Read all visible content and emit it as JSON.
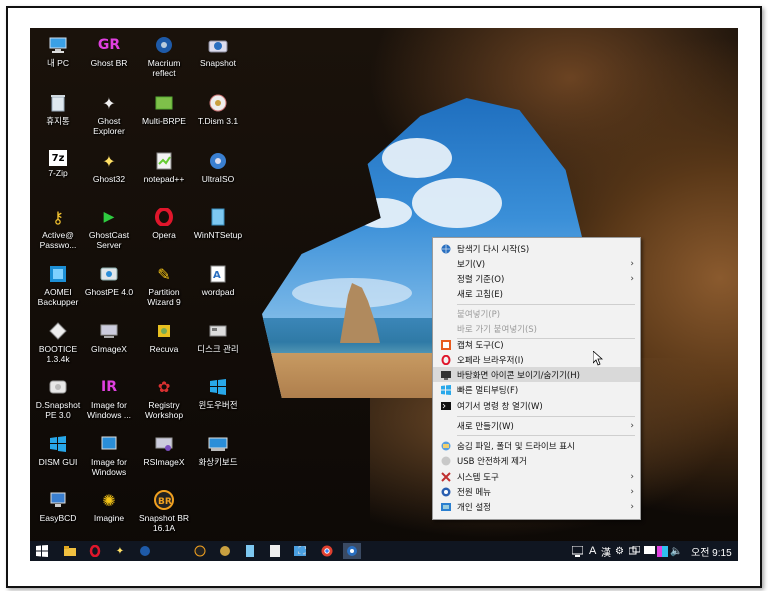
{
  "desktop_icons": [
    {
      "label": "내 PC"
    },
    {
      "label": "휴지통"
    },
    {
      "label": "7-Zip"
    },
    {
      "label": "Active@ Passwo..."
    },
    {
      "label": "AOMEI Backupper"
    },
    {
      "label": "BOOTICE 1.3.4k"
    },
    {
      "label": "D.Snapshot PE 3.0"
    },
    {
      "label": "DISM GUI"
    },
    {
      "label": "EasyBCD"
    },
    {
      "label": "Ghost BR"
    },
    {
      "label": "Ghost Explorer"
    },
    {
      "label": "Ghost32"
    },
    {
      "label": "GhostCast Server"
    },
    {
      "label": "GhostPE 4.0"
    },
    {
      "label": "GImageX"
    },
    {
      "label": "Image for Windows ..."
    },
    {
      "label": "Image for Windows"
    },
    {
      "label": "Imagine"
    },
    {
      "label": "Macrium reflect"
    },
    {
      "label": "Multi-BRPE"
    },
    {
      "label": "notepad++"
    },
    {
      "label": "Opera"
    },
    {
      "label": "Partition Wizard 9"
    },
    {
      "label": "Recuva"
    },
    {
      "label": "Registry Workshop"
    },
    {
      "label": "RSImageX"
    },
    {
      "label": "Snapshot BR 16.1A"
    },
    {
      "label": "Snapshot"
    },
    {
      "label": "T.Dism 3.1"
    },
    {
      "label": "UltraISO"
    },
    {
      "label": "WinNTSetup"
    },
    {
      "label": "wordpad"
    },
    {
      "label": "디스크 관리"
    },
    {
      "label": "윈도우버전"
    },
    {
      "label": "화상키보드"
    }
  ],
  "context_menu": {
    "items": [
      {
        "label": "탐색기 다시 시작(S)",
        "icon": "globe-icon"
      },
      {
        "label": "보기(V)",
        "submenu": "›"
      },
      {
        "label": "정렬 기준(O)",
        "submenu": "›"
      },
      {
        "label": "새로 고침(E)"
      },
      {
        "label": "붙여넣기(P)",
        "disabled": true
      },
      {
        "label": "바로 가기 붙여넣기(S)",
        "disabled": true
      },
      {
        "label": "캡쳐 도구(C)",
        "icon": "scissors-icon"
      },
      {
        "label": "오페라 브라우저(I)",
        "icon": "opera-icon"
      },
      {
        "label": "바탕화면 아이콘 보이기/숨기기(H)",
        "icon": "desktop-icon"
      },
      {
        "label": "빠른 멀티부팅(F)",
        "icon": "windows-icon"
      },
      {
        "label": "여기서 명령 창 열기(W)",
        "icon": "cmd-icon"
      },
      {
        "label": "새로 만들기(W)",
        "submenu": "›"
      },
      {
        "label": "숨김 파일, 폴더 및 드라이브 표시",
        "icon": "folder-icon"
      },
      {
        "label": "USB 안전하게 제거",
        "icon": "usb-icon"
      },
      {
        "label": "시스템 도구",
        "icon": "tools-icon",
        "submenu": "›"
      },
      {
        "label": "전원 메뉴",
        "icon": "power-icon",
        "submenu": "›"
      },
      {
        "label": "개인 설정",
        "icon": "personalize-icon",
        "submenu": "›"
      }
    ]
  },
  "taskbar": {
    "tray_a": "A",
    "tray_han": "漢",
    "clock": "오전 9:15"
  },
  "colors": {
    "taskbar": "#101621",
    "menu_bg": "#f2f2f2",
    "menu_highlight": "#d9d9d9"
  }
}
